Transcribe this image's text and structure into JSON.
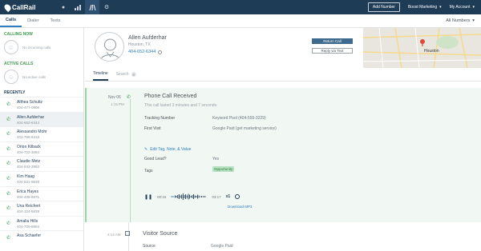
{
  "app": {
    "logo_text": "CallRail"
  },
  "topbar": {
    "nav_icons": [
      "chat-icon",
      "chart-icon",
      "routing-icon",
      "gear-icon"
    ],
    "add_number_label": "Add Number",
    "account_menu_label": "Boost Marketing",
    "my_account_label": "My Account"
  },
  "subbar": {
    "tabs": [
      {
        "label": "Calls",
        "active": true
      },
      {
        "label": "Dialer",
        "active": false
      },
      {
        "label": "Texts",
        "active": false
      }
    ],
    "filter_label": "All Numbers"
  },
  "sidebar": {
    "calling_now_title": "CALLING NOW",
    "calling_now_empty": "No incoming calls",
    "active_calls_title": "ACTIVE CALLS",
    "active_calls_empty": "No active calls",
    "recent_title": "RECENTLY",
    "recent": [
      {
        "name": "Althea Schultz",
        "number": "404-477-0806"
      },
      {
        "name": "Allen Aufderhar",
        "number": "404-652-6344"
      },
      {
        "name": "Alessandro Mohr",
        "number": "404-768-6318"
      },
      {
        "name": "Orion Kilback",
        "number": "404-722-3084"
      },
      {
        "name": "Claudie Metz",
        "number": "404-843-3992"
      },
      {
        "name": "Kim Haag",
        "number": "404-831-9839"
      },
      {
        "name": "Erica Hayes",
        "number": "404-408-8971"
      },
      {
        "name": "Una Reichert",
        "number": "404-324-6839"
      },
      {
        "name": "Amalia Hills",
        "number": "404-700-8804"
      },
      {
        "name": "Asa Schaefer",
        "number": ""
      }
    ]
  },
  "contact": {
    "name": "Allen Aufderhar",
    "location": "Houston, TX",
    "phone": "404-652-6344",
    "return_call_label": "Return Call",
    "reply_text_label": "Reply via Text",
    "map_label": "Houston"
  },
  "timeline": {
    "tabs": [
      {
        "label": "Timeline",
        "active": true
      },
      {
        "label": "Search",
        "active": false,
        "count": "0"
      }
    ]
  },
  "event": {
    "date": "Nov 06",
    "time": "1:15 PM",
    "title": "Phone Call Received",
    "subtitle": "This call lasted 3 minutes and 7 seconds.",
    "tracking_label": "Tracking Number",
    "tracking_value": "Keyword Pool (404-555-3229)",
    "first_visit_label": "First Visit",
    "first_visit_value": "Google Paid (get marketing service)",
    "edit_label": "Edit Tag, Note, & Value",
    "good_lead_label": "Good Lead?",
    "good_lead_value": "Yes",
    "tags_label": "Tags",
    "tag_value": "Opportunity",
    "player": {
      "elapsed": "00:16",
      "duration": "03:17",
      "speed": "x1",
      "progress": 0.08
    },
    "download_label": "Download MP3"
  },
  "visitor_source": {
    "time": "4:14 AM",
    "title": "Visitor Source",
    "source_label": "Source",
    "source_value": "Google Paid"
  }
}
